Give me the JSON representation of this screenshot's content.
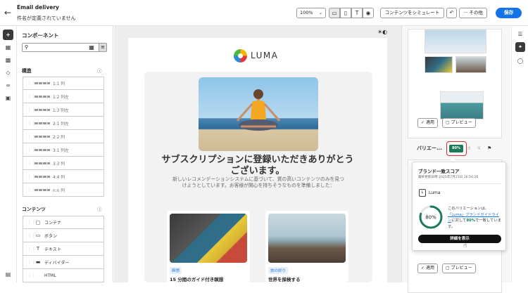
{
  "header": {
    "title": "Email delivery",
    "subtitle": "件名が定義されていません",
    "zoom": "100%",
    "simulate_label": "コンテンツをシミュレート",
    "more_label": "その他",
    "save_label": "保存"
  },
  "components_panel": {
    "title": "コンポーネント",
    "search_placeholder": "",
    "structure_heading": "構造",
    "structures": [
      "1:1 列",
      "1:2 列左",
      "1:3 列左",
      "2:1 列左",
      "2:2 列",
      "3:1 列左",
      "3:3 列",
      "4:4 列",
      "n:n 列"
    ],
    "content_heading": "コンテンツ",
    "contents": [
      {
        "label": "コンテナ",
        "icon": "container-icon"
      },
      {
        "label": "ボタン",
        "icon": "button-icon"
      },
      {
        "label": "テキスト",
        "icon": "text-icon"
      },
      {
        "label": "ディバイダー",
        "icon": "divider-icon"
      },
      {
        "label": "HTML",
        "icon": "html-icon"
      }
    ]
  },
  "email": {
    "brand": "LUMA",
    "headline": "サブスクリプションに登録いただきありがとうございます。",
    "body": "新しいレコメンデーションシステムに基づいて、質の高いコンテンツのみを見つけようとしています。お客様が関心を持ちそうなものを準備しました：",
    "articles": [
      {
        "tag": "瞑想",
        "title": "15 分間のガイド付き瞑想"
      },
      {
        "tag": "旅の終り",
        "title": "世界を探検する"
      }
    ]
  },
  "properties": {
    "apply_label": "適用",
    "preview_label": "プレビュー",
    "variation_label": "バリエー...",
    "score_badge": "80%"
  },
  "popover": {
    "title": "ブランド一致スコア",
    "last_updated": "最終更新日時 2025年7月21日 16:54:26",
    "brand_name": "Luma",
    "score": "80%",
    "score_value": 0.8,
    "text_before": "このバリエーションは、",
    "link_text": "「Luma」ブランドガイドライン",
    "text_mid": "に対して",
    "text_pct": "80%",
    "text_after": "で一致しています。",
    "details_button": "詳細を表示",
    "accent": "#1c7a5a"
  }
}
